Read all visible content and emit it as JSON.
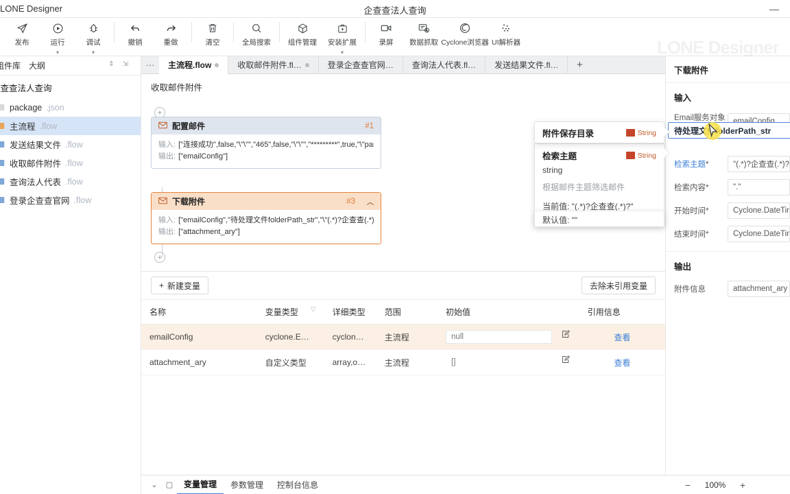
{
  "titlebar": {
    "app_title": "LONE Designer",
    "doc_title": "企查查法人查询",
    "minimize": "—"
  },
  "toolbar": {
    "items": [
      {
        "label": "发布",
        "icon": "publish-icon",
        "caret": false
      },
      {
        "label": "运行",
        "icon": "run-icon",
        "caret": true
      },
      {
        "label": "调试",
        "icon": "debug-icon",
        "caret": true
      },
      {
        "label": "撤销",
        "icon": "undo-icon",
        "caret": false
      },
      {
        "label": "重做",
        "icon": "redo-icon",
        "caret": false
      },
      {
        "label": "清空",
        "icon": "trash-icon",
        "caret": false
      },
      {
        "label": "全局搜索",
        "icon": "search-icon",
        "caret": false
      },
      {
        "label": "组件管理",
        "icon": "package-icon",
        "caret": false
      },
      {
        "label": "安装扩展",
        "icon": "toolbox-icon",
        "caret": true
      },
      {
        "label": "录屏",
        "icon": "video-icon",
        "caret": false
      },
      {
        "label": "数据抓取",
        "icon": "data-capture-icon",
        "caret": false
      },
      {
        "label": "Cyclone浏览器",
        "icon": "cyclone-browser-icon",
        "caret": false
      },
      {
        "label": "UI解析器",
        "icon": "ui-parser-icon",
        "caret": false
      }
    ],
    "watermark": "LONE Designer"
  },
  "sidebar": {
    "tabs": [
      "组件库",
      "大纲"
    ],
    "project_name": "企查查法人查询",
    "files": [
      {
        "name": "package",
        "ext": ".json",
        "selected": false
      },
      {
        "name": "主流程",
        "ext": ".flow",
        "selected": true
      },
      {
        "name": "发送结果文件",
        "ext": ".flow",
        "selected": false
      },
      {
        "name": "收取邮件附件",
        "ext": ".flow",
        "selected": false
      },
      {
        "name": "查询法人代表",
        "ext": ".flow",
        "selected": false
      },
      {
        "name": "登录企查查官网",
        "ext": ".flow",
        "selected": false
      }
    ]
  },
  "tabbar": {
    "overflow": "···",
    "add": "+",
    "tabs": [
      {
        "label": "主流程.flow",
        "active": true,
        "dot": true
      },
      {
        "label": "收取邮件附件.fl…",
        "active": false,
        "dot": true
      },
      {
        "label": "登录企查查官网…",
        "active": false,
        "dot": false
      },
      {
        "label": "查询法人代表.fl…",
        "active": false,
        "dot": false
      },
      {
        "label": "发送结果文件.fl…",
        "active": false,
        "dot": false
      }
    ]
  },
  "canvas": {
    "title": "收取邮件附件",
    "add_node_glyph": "+",
    "nodes": [
      {
        "title": "配置邮件",
        "number": "#1",
        "icon": "mail-icon",
        "input_label": "输入:",
        "input_value": "[\"连接成功\",false,\"\\\"\\\"\",\"465\",false,\"\\\"\\\"\",\"*********\",true,\"\\\"partı",
        "output_label": "输出:",
        "output_value": "[\"emailConfig\"]",
        "style": "blue",
        "collapse": ""
      },
      {
        "title": "下载附件",
        "number": "#3",
        "icon": "mail-icon",
        "input_label": "输入:",
        "input_value": "[\"emailConfig\",\"待处理文件folderPath_str\",\"\\\"(.*)?企查查(.*)?\\\"\"",
        "output_label": "输出:",
        "output_value": "[\"attachment_ary\"]",
        "style": "orange",
        "collapse": "︿"
      }
    ]
  },
  "popups": {
    "front": {
      "title": "附件保存目录",
      "type_label": "String"
    },
    "back": {
      "title": "检索主题",
      "type_label": "String",
      "value_type": "string",
      "description": "根据邮件主题筛选邮件",
      "current_label": "当前值: \"(.*)?企查查(.*)?\"",
      "default_label": "默认值: \"\""
    },
    "ghost": {
      "line1": "附件保存目录",
      "line2": "待处理文件folderPath_str",
      "line3": "默认值: \"\""
    }
  },
  "variables": {
    "new_var_button": "新建变量",
    "new_var_icon": "+",
    "clean_button": "去除未引用变量",
    "columns": [
      "名称",
      "变量类型",
      "详细类型",
      "范围",
      "初始值",
      "引用信息"
    ],
    "filter_icon": "filter-icon",
    "rows": [
      {
        "name": "emailConfig",
        "type": "cyclone.Ema…",
        "detail": "cyclone.E…",
        "scope": "主流程",
        "initial": "null",
        "ref": "查看",
        "highlight": true
      },
      {
        "name": "attachment_ary",
        "type": "自定义类型",
        "detail": "array,obj…",
        "scope": "主流程",
        "initial": "[]",
        "ref": "查看",
        "highlight": false
      }
    ]
  },
  "bottombar": {
    "collapse_icon": "chevron-down-icon",
    "panel_icon": "panel-icon",
    "tabs": [
      {
        "label": "变量管理",
        "active": true
      },
      {
        "label": "参数管理",
        "active": false
      },
      {
        "label": "控制台信息",
        "active": false
      }
    ],
    "zoom_out": "−",
    "zoom_value": "100%",
    "zoom_in": "+"
  },
  "properties": {
    "panel_title": "下载附件",
    "input_section": "输入",
    "output_section": "输出",
    "input_fields": [
      {
        "label": "Email服务对象",
        "required": "*",
        "value": "emailConfig",
        "active": false
      },
      {
        "label": "检索主题",
        "required": "*",
        "value": "\"(.*)?企查查(.*)?\"",
        "active": true
      },
      {
        "label": "检索内容",
        "required": "*",
        "value": "\".\"",
        "active": false
      },
      {
        "label": "开始时间",
        "required": "*",
        "value": "Cyclone.DateTime",
        "active": false
      },
      {
        "label": "结束时间",
        "required": "*",
        "value": "Cyclone.DateTime",
        "active": false
      }
    ],
    "output_fields": [
      {
        "label": "附件信息",
        "required": "",
        "value": "attachment_ary",
        "active": false
      }
    ],
    "drag_chip": "待处理文件folderPath_str",
    "cursor": "cursor-arrow"
  },
  "colors": {
    "accent_blue": "#3a7fd5",
    "accent_orange": "#e8833a",
    "node_head_blue": "#dfe5ee",
    "node_head_orange": "#fadfc8",
    "row_highlight": "#fcf0e4",
    "sidebar_selected": "#d6e4f7",
    "cursor_halo": "#f7e04a"
  }
}
